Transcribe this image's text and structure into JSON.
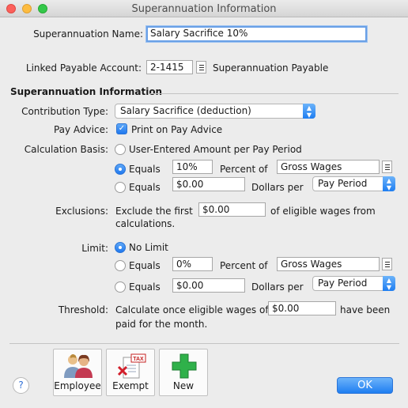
{
  "window": {
    "title": "Superannuation Information"
  },
  "name": {
    "label": "Superannuation Name:",
    "value": "Salary Sacrifice 10%"
  },
  "linked": {
    "label": "Linked Payable Account:",
    "account": "2-1415",
    "account_name": "Superannuation Payable"
  },
  "section_title": "Superannuation Information",
  "contribution": {
    "label": "Contribution Type:",
    "value": "Salary Sacrifice (deduction)"
  },
  "pay_advice": {
    "label": "Pay Advice:",
    "checkbox_label": "Print on Pay Advice",
    "checked": true
  },
  "calc": {
    "label": "Calculation Basis:",
    "option_user": "User-Entered Amount per Pay Period",
    "equals_label": "Equals",
    "percent_value": "10%",
    "percent_of_label": "Percent of",
    "percent_of_value": "Gross Wages",
    "dollars_value": "$0.00",
    "dollars_per_label": "Dollars per",
    "dollars_per_value": "Pay Period",
    "selected": "percent"
  },
  "exclusions": {
    "label": "Exclusions:",
    "text_before": "Exclude the first",
    "value": "$0.00",
    "text_after": "of eligible wages from",
    "text_line2": "calculations."
  },
  "limit": {
    "label": "Limit:",
    "option_none": "No Limit",
    "equals_label": "Equals",
    "percent_value": "0%",
    "percent_of_label": "Percent of",
    "percent_of_value": "Gross Wages",
    "dollars_value": "$0.00",
    "dollars_per_label": "Dollars per",
    "dollars_per_value": "Pay Period",
    "selected": "none"
  },
  "threshold": {
    "label": "Threshold:",
    "text_before": "Calculate once eligible wages of",
    "value": "$0.00",
    "text_after": "have been",
    "text_line2": "paid for the month."
  },
  "buttons": {
    "employee": "Employee",
    "exempt": "Exempt",
    "new": "New",
    "ok": "OK",
    "help": "?",
    "tax_badge": "TAX"
  },
  "colors": {
    "accent": "#1f7ef1",
    "background": "#ececec"
  }
}
